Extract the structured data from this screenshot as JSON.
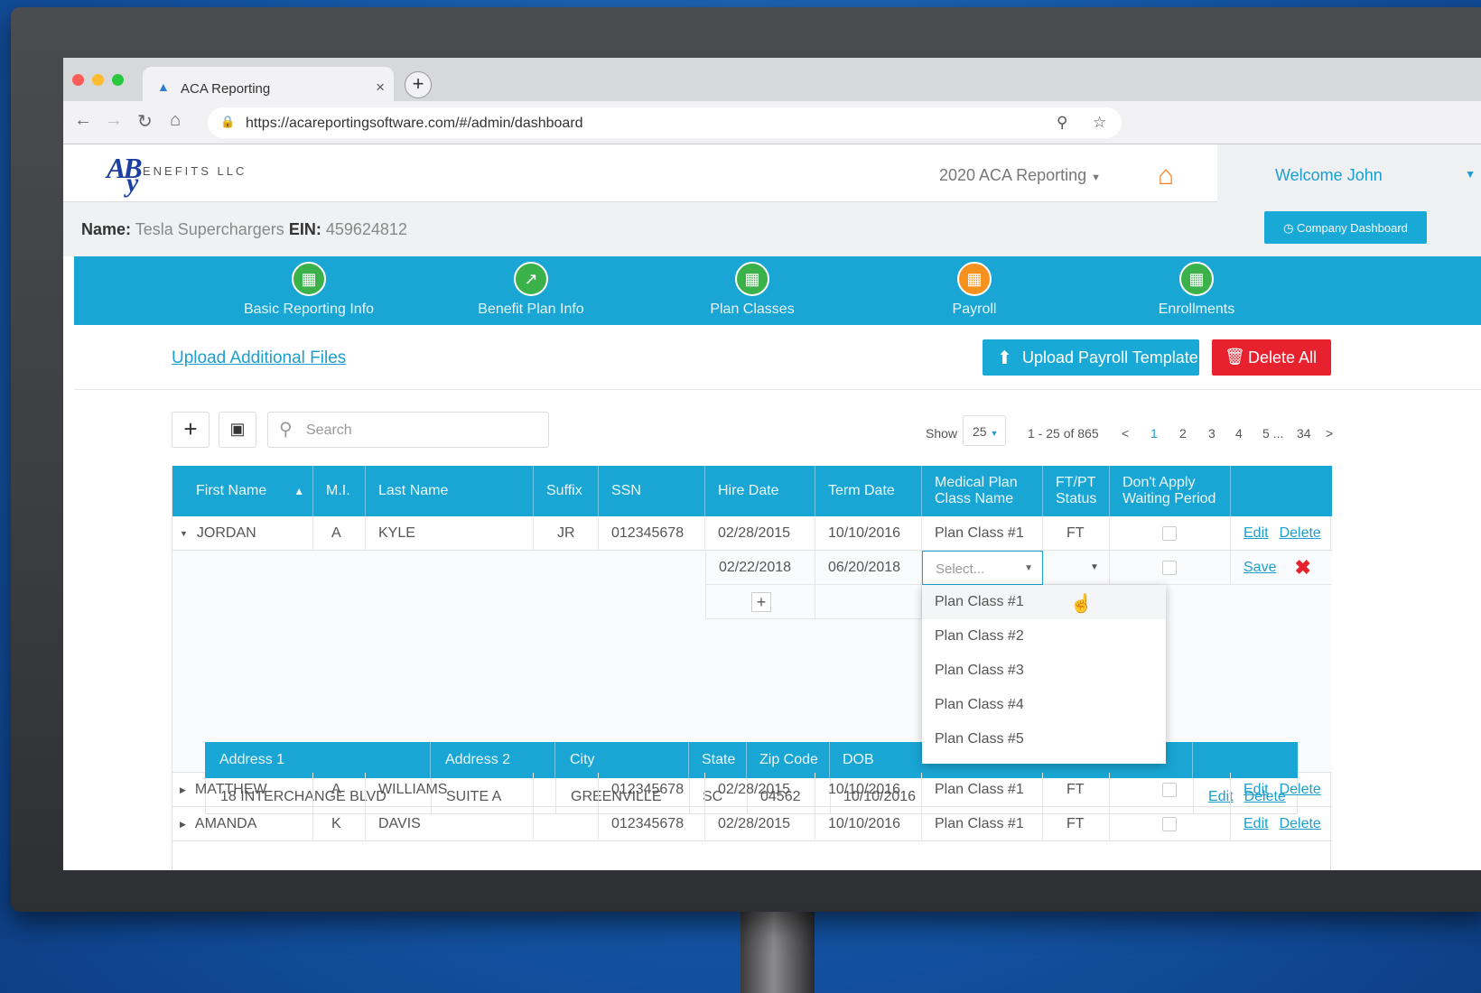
{
  "browser": {
    "tab_title": "ACA Reporting",
    "url": "https://acareportingsoftware.com/#/admin/dashboard"
  },
  "header": {
    "logo_letters": "AB",
    "logo_y": "y",
    "logo_text": "ENEFITS LLC",
    "reporting_label": "2020 ACA Reporting",
    "welcome": "Welcome John"
  },
  "company": {
    "name_label": "Name:",
    "name": "Tesla Superchargers",
    "ein_label": "EIN:",
    "ein": "459624812",
    "dashboard_button": "Company Dashboard"
  },
  "steps": [
    {
      "label": "Basic Reporting Info"
    },
    {
      "label": "Benefit Plan Info"
    },
    {
      "label": "Plan Classes"
    },
    {
      "label": "Payroll"
    },
    {
      "label": "Enrollments"
    }
  ],
  "actions": {
    "upload_files": "Upload Additional Files",
    "upload_template": "Upload Payroll Template",
    "delete_all": "Delete All"
  },
  "toolbar": {
    "search_placeholder": "Search",
    "show_label": "Show",
    "page_size": "25",
    "range": "1 - 25 of 865",
    "pages": [
      "1",
      "2",
      "3",
      "4",
      "5 ...",
      "34"
    ]
  },
  "columns": [
    "First Name",
    "M.I.",
    "Last Name",
    "Suffix",
    "SSN",
    "Hire Date",
    "Term Date",
    "Medical Plan Class Name",
    "FT/PT Status",
    "Don't Apply Waiting Period"
  ],
  "rows": [
    {
      "first": "JORDAN",
      "mi": "A",
      "last": "KYLE",
      "suffix": "JR",
      "ssn": "012345678",
      "hire": "02/28/2015",
      "term": "10/10/2016",
      "plan": "Plan Class #1",
      "status": "FT"
    },
    {
      "first": "MATTHEW",
      "mi": "A",
      "last": "WILLIAMS",
      "suffix": "",
      "ssn": "012345678",
      "hire": "02/28/2015",
      "term": "10/10/2016",
      "plan": "Plan Class #1",
      "status": "FT"
    },
    {
      "first": "AMANDA",
      "mi": "K",
      "last": "DAVIS",
      "suffix": "",
      "ssn": "012345678",
      "hire": "02/28/2015",
      "term": "10/10/2016",
      "plan": "Plan Class #1",
      "status": "FT"
    }
  ],
  "edit_row": {
    "hire": "02/22/2018",
    "term": "06/20/2018",
    "select_placeholder": "Select...",
    "save": "Save"
  },
  "links": {
    "edit": "Edit",
    "delete": "Delete"
  },
  "dropdown_options": [
    "Plan Class #1",
    "Plan Class #2",
    "Plan Class #3",
    "Plan Class #4",
    "Plan Class #5"
  ],
  "address": {
    "columns": [
      "Address 1",
      "Address 2",
      "City",
      "State",
      "Zip Code",
      "DOB"
    ],
    "values": [
      "18 INTERCHANGE BLVD",
      "SUITE A",
      "GREENVILLE",
      "SC",
      "04562",
      "10/10/2016"
    ]
  },
  "colors": {
    "accent": "#19a6d4",
    "danger": "#e8212f",
    "home": "#f5821f"
  }
}
